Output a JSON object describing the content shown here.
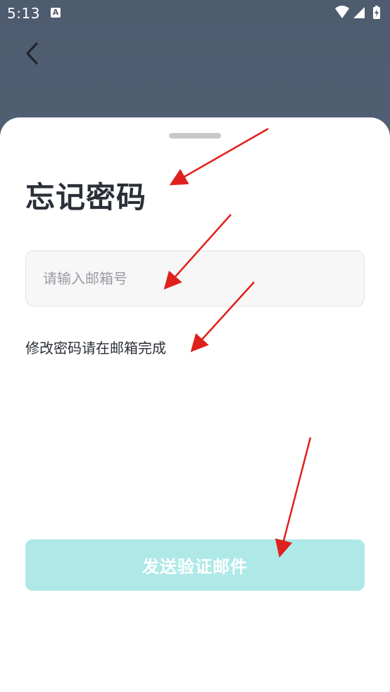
{
  "status_bar": {
    "time": "5:13",
    "badge": "A"
  },
  "page": {
    "title": "忘记密码",
    "email_placeholder": "请输入邮箱号",
    "email_value": "",
    "hint": "修改密码请在邮箱完成",
    "send_button": "发送验证邮件"
  },
  "colors": {
    "background_top": "#4e5c70",
    "sheet": "#ffffff",
    "button_disabled": "#aee9e8",
    "annotation_arrow": "#e0201c"
  },
  "icons": [
    "back-chevron-icon",
    "wifi-icon",
    "signal-icon",
    "battery-icon"
  ]
}
